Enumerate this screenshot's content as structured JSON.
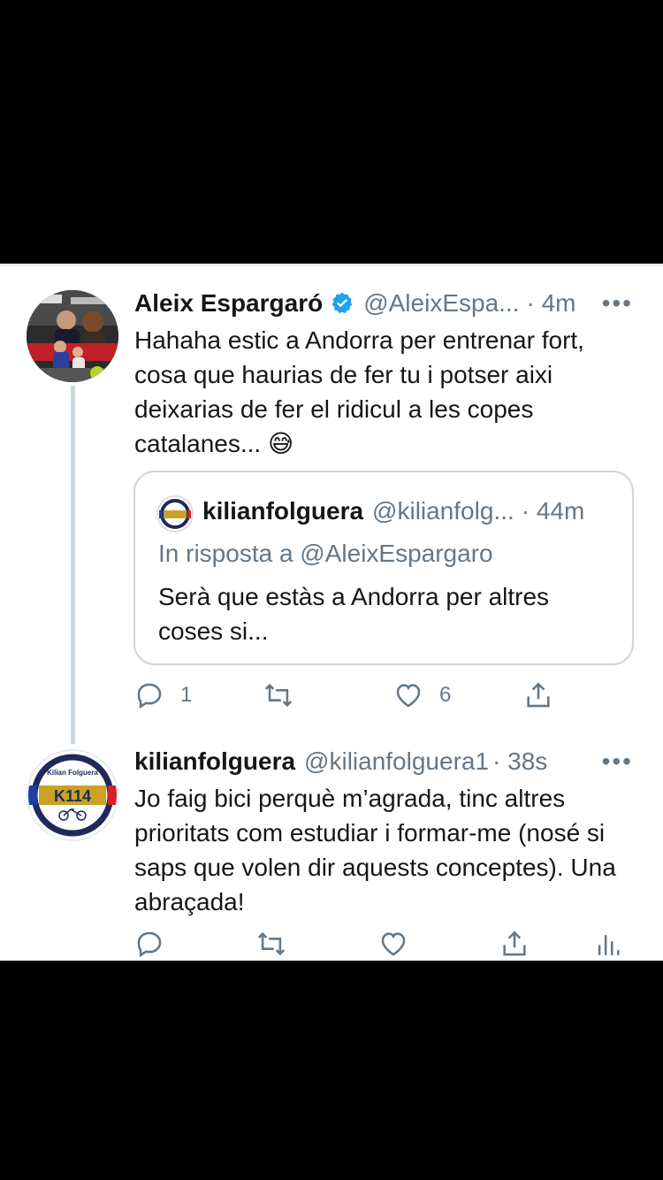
{
  "tweet1": {
    "name": "Aleix Espargaró",
    "handle": "@AleixEspa...",
    "time": "· 4m",
    "text": "Hahaha estic a Andorra per entrenar fort, cosa que haurias de fer tu i potser aixi deixarias de fer el ridicul a les copes catalanes... 😅",
    "quote": {
      "name": "kilianfolguera",
      "handle": "@kilianfolg...",
      "time": "· 44m",
      "reply_to": "In risposta a @AleixEspargaro",
      "text": "Serà que estàs a Andorra per altres coses si..."
    },
    "replies": "1",
    "likes": "6"
  },
  "tweet2": {
    "name": "kilianfolguera",
    "handle": "@kilianfolguera1",
    "time": "· 38s",
    "text": "Jo faig bici perquè m’agrada, tinc altres prioritats com estudiar i formar-me (nosé si saps que volen dir aquests conceptes). Una abraçada!",
    "avatar_top": "Kilian Folguera",
    "avatar_mark": "K114"
  },
  "more_label": "•••",
  "colors": {
    "secondary": "#657786",
    "verified": "#1da1f2",
    "divider": "#ccd6dd"
  }
}
